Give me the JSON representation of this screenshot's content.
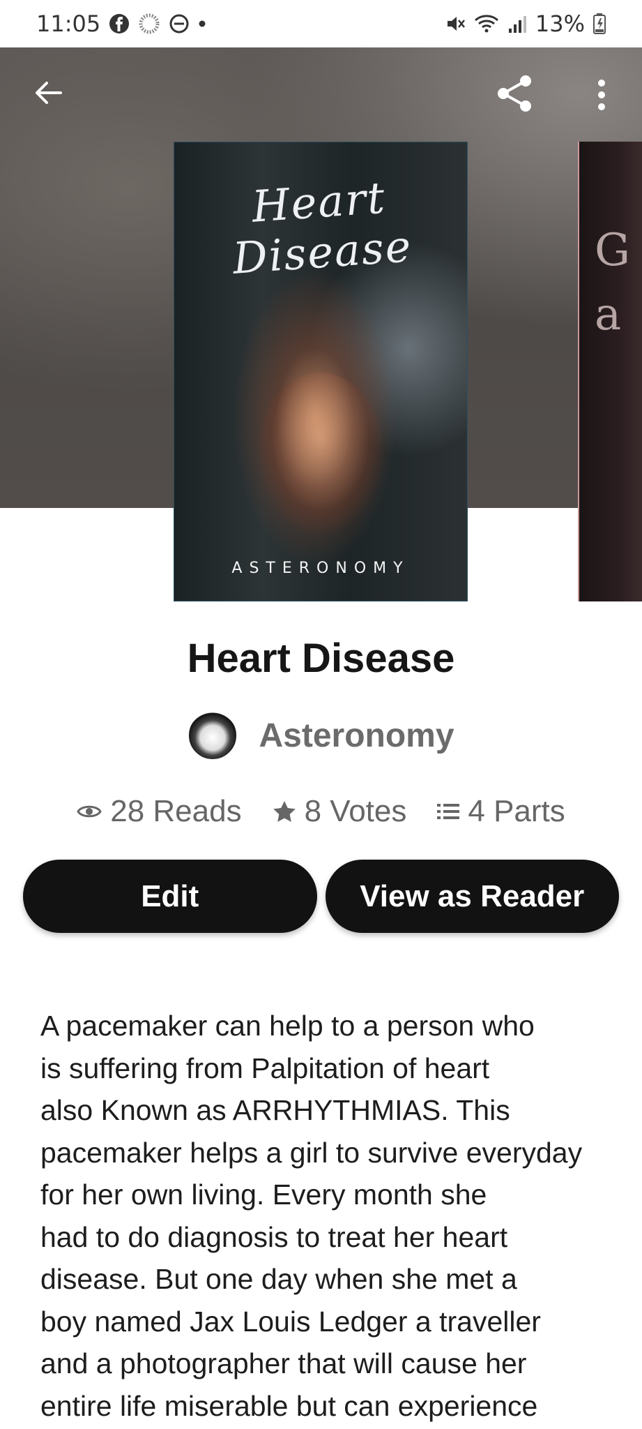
{
  "status": {
    "time": "11:05",
    "battery": "13%"
  },
  "book": {
    "title": "Heart Disease",
    "cover_title": "Heart Disease",
    "cover_author": "ASTERONOMY",
    "author": "Asteronomy",
    "peek_text": "G\na"
  },
  "stats": {
    "reads": "28 Reads",
    "votes": "8 Votes",
    "parts": "4 Parts"
  },
  "actions": {
    "edit": "Edit",
    "view_as_reader": "View as Reader"
  },
  "description": "A pacemaker can help to a person who\nis suffering from Palpitation of heart\nalso Known as  ARRHYTHMIAS.  This\npacemaker helps a girl to survive everyday\nfor her own living. Every month she\nhad to do diagnosis to treat her heart\ndisease. But one day when she met a\nboy named Jax Louis Ledger a traveller\nand a photographer that will cause her\nentire life miserable but can experience",
  "icons": [
    "facebook-icon",
    "loading-icon",
    "dnd-icon",
    "mute-icon",
    "wifi-icon",
    "signal-icon",
    "battery-icon",
    "back-arrow-icon",
    "share-icon",
    "more-vert-icon",
    "eye-icon",
    "star-icon",
    "list-icon"
  ]
}
